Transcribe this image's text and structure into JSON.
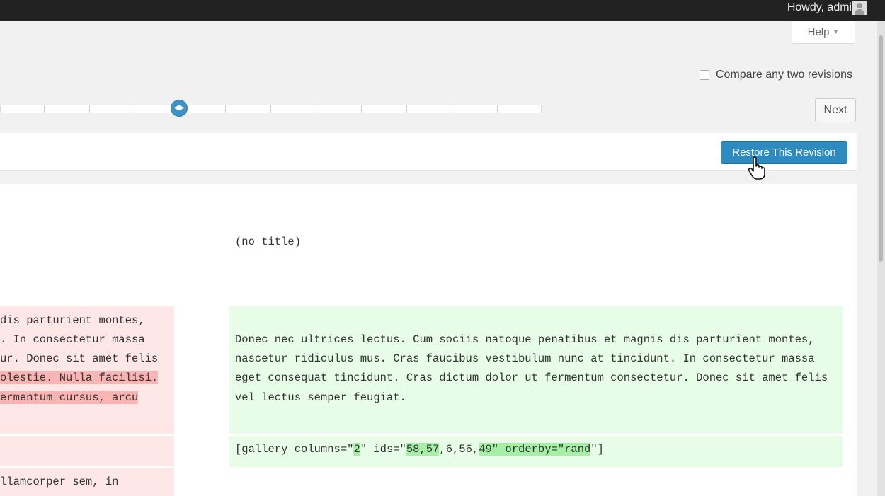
{
  "adminbar": {
    "howdy": "Howdy, admin"
  },
  "help": {
    "label": "Help"
  },
  "compare": {
    "label": "Compare any two revisions",
    "checked": false
  },
  "nav": {
    "next_label": "Next"
  },
  "restore": {
    "label": "Restore This Revision"
  },
  "diff": {
    "title": "(no title)",
    "removed_lines": [
      "dis parturient montes,",
      ". In consectetur massa",
      "ur. Donec sit amet felis",
      "olestie. Nulla facilisi.",
      "ermentum cursus, arcu",
      "llamcorper sem, in"
    ],
    "added_lines": [
      "Donec nec ultrices lectus. Cum sociis natoque penatibus et magnis dis parturient montes,",
      "nascetur ridiculus mus. Cras faucibus vestibulum nunc at tincidunt. In consectetur massa",
      "eget consequat tincidunt. Cras dictum dolor ut fermentum consectetur. Donec sit amet felis",
      "vel lectus semper feugiat."
    ],
    "gallery": {
      "p1": "[gallery columns=\"",
      "h1": "2",
      "p2": "\" ids=\"",
      "h2": "58,57",
      "p3": ",6,56,",
      "h3": "49\" orderby=\"rand",
      "p4": "\"]"
    }
  }
}
